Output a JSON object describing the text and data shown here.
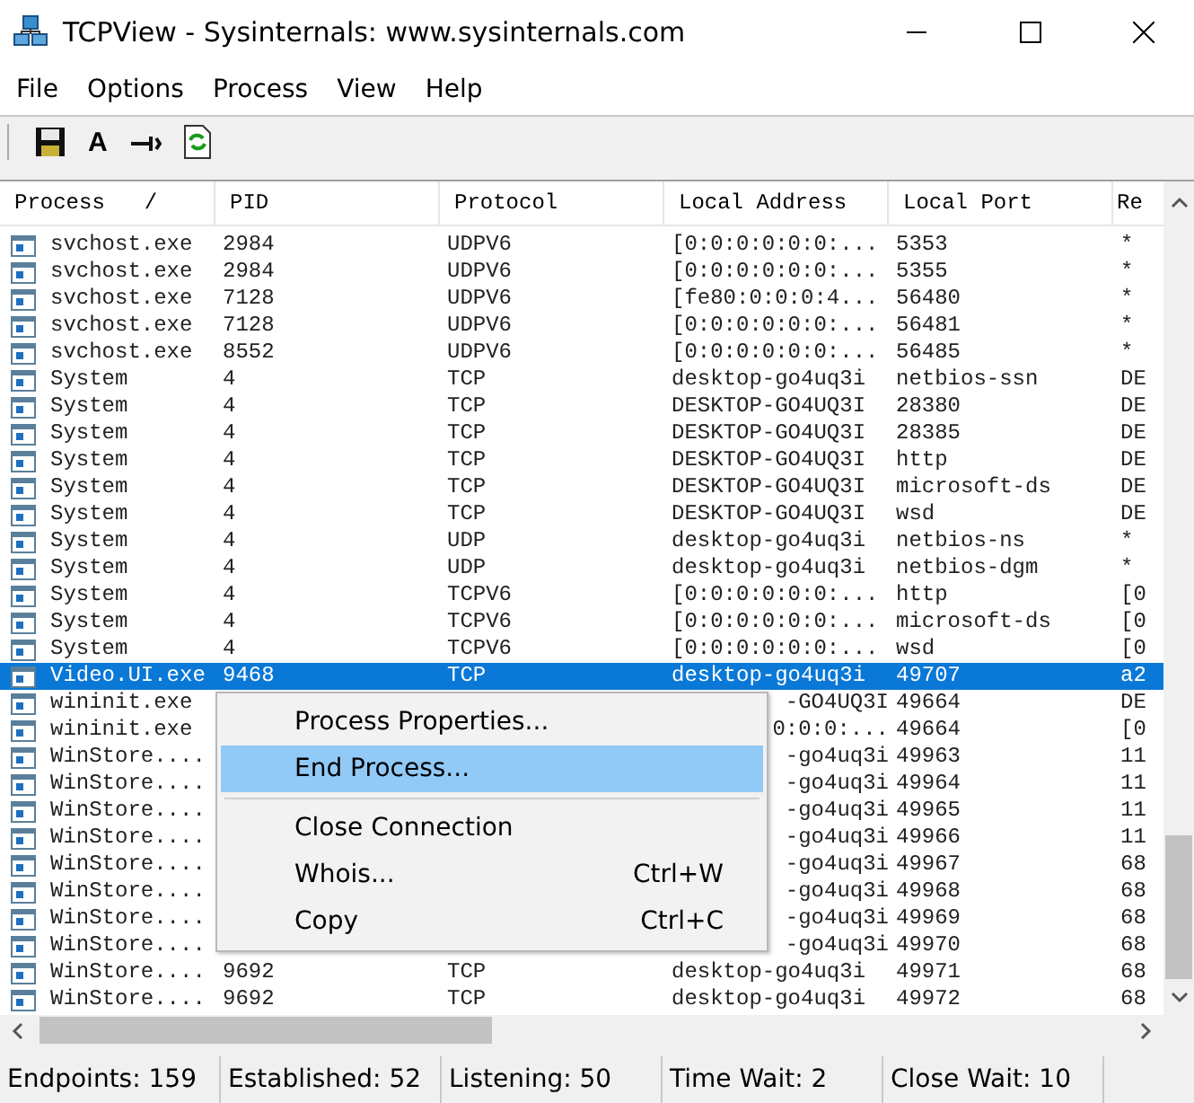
{
  "window": {
    "title": "TCPView - Sysinternals: www.sysinternals.com"
  },
  "menu_bar": [
    "File",
    "Options",
    "Process",
    "View",
    "Help"
  ],
  "toolbar": [
    {
      "kind": "save"
    },
    {
      "kind": "glyph",
      "label": "A"
    },
    {
      "kind": "connector"
    },
    {
      "kind": "refresh"
    }
  ],
  "table": {
    "columns": [
      {
        "label": "Process",
        "sort_indicator": "/"
      },
      {
        "label": "PID"
      },
      {
        "label": "Protocol"
      },
      {
        "label": "Local Address"
      },
      {
        "label": "Local Port"
      },
      {
        "label": "Re"
      }
    ],
    "rows": [
      {
        "cells": [
          "svchost.exe",
          "2984",
          "UDPV6",
          "[0:0:0:0:0:0:...",
          "5353",
          "*"
        ],
        "selected": false
      },
      {
        "cells": [
          "svchost.exe",
          "2984",
          "UDPV6",
          "[0:0:0:0:0:0:...",
          "5355",
          "*"
        ],
        "selected": false
      },
      {
        "cells": [
          "svchost.exe",
          "7128",
          "UDPV6",
          "[fe80:0:0:0:4...",
          "56480",
          "*"
        ],
        "selected": false
      },
      {
        "cells": [
          "svchost.exe",
          "7128",
          "UDPV6",
          "[0:0:0:0:0:0:...",
          "56481",
          "*"
        ],
        "selected": false
      },
      {
        "cells": [
          "svchost.exe",
          "8552",
          "UDPV6",
          "[0:0:0:0:0:0:...",
          "56485",
          "*"
        ],
        "selected": false
      },
      {
        "cells": [
          "System",
          "4",
          "TCP",
          "desktop-go4uq3i",
          "netbios-ssn",
          "DE"
        ],
        "selected": false
      },
      {
        "cells": [
          "System",
          "4",
          "TCP",
          "DESKTOP-GO4UQ3I",
          "28380",
          "DE"
        ],
        "selected": false
      },
      {
        "cells": [
          "System",
          "4",
          "TCP",
          "DESKTOP-GO4UQ3I",
          "28385",
          "DE"
        ],
        "selected": false
      },
      {
        "cells": [
          "System",
          "4",
          "TCP",
          "DESKTOP-GO4UQ3I",
          "http",
          "DE"
        ],
        "selected": false
      },
      {
        "cells": [
          "System",
          "4",
          "TCP",
          "DESKTOP-GO4UQ3I",
          "microsoft-ds",
          "DE"
        ],
        "selected": false
      },
      {
        "cells": [
          "System",
          "4",
          "TCP",
          "DESKTOP-GO4UQ3I",
          "wsd",
          "DE"
        ],
        "selected": false
      },
      {
        "cells": [
          "System",
          "4",
          "UDP",
          "desktop-go4uq3i",
          "netbios-ns",
          "*"
        ],
        "selected": false
      },
      {
        "cells": [
          "System",
          "4",
          "UDP",
          "desktop-go4uq3i",
          "netbios-dgm",
          "*"
        ],
        "selected": false
      },
      {
        "cells": [
          "System",
          "4",
          "TCPV6",
          "[0:0:0:0:0:0:...",
          "http",
          "[0"
        ],
        "selected": false
      },
      {
        "cells": [
          "System",
          "4",
          "TCPV6",
          "[0:0:0:0:0:0:...",
          "microsoft-ds",
          "[0"
        ],
        "selected": false
      },
      {
        "cells": [
          "System",
          "4",
          "TCPV6",
          "[0:0:0:0:0:0:...",
          "wsd",
          "[0"
        ],
        "selected": false
      },
      {
        "cells": [
          "Video.UI.exe",
          "9468",
          "TCP",
          "desktop-go4uq3i",
          "49707",
          "a2"
        ],
        "selected": true
      },
      {
        "cells": [
          "wininit.exe",
          null,
          null,
          "-GO4UQ3I",
          "49664",
          "DE"
        ],
        "selected": false
      },
      {
        "cells": [
          "wininit.exe",
          null,
          null,
          "0:0:0:...",
          "49664",
          "[0"
        ],
        "selected": false
      },
      {
        "cells": [
          "WinStore....",
          null,
          null,
          "-go4uq3i",
          "49963",
          "11"
        ],
        "selected": false
      },
      {
        "cells": [
          "WinStore....",
          null,
          null,
          "-go4uq3i",
          "49964",
          "11"
        ],
        "selected": false
      },
      {
        "cells": [
          "WinStore....",
          null,
          null,
          "-go4uq3i",
          "49965",
          "11"
        ],
        "selected": false
      },
      {
        "cells": [
          "WinStore....",
          null,
          null,
          "-go4uq3i",
          "49966",
          "11"
        ],
        "selected": false
      },
      {
        "cells": [
          "WinStore....",
          null,
          null,
          "-go4uq3i",
          "49967",
          "68"
        ],
        "selected": false
      },
      {
        "cells": [
          "WinStore....",
          null,
          null,
          "-go4uq3i",
          "49968",
          "68"
        ],
        "selected": false
      },
      {
        "cells": [
          "WinStore....",
          null,
          null,
          "-go4uq3i",
          "49969",
          "68"
        ],
        "selected": false
      },
      {
        "cells": [
          "WinStore....",
          null,
          null,
          "-go4uq3i",
          "49970",
          "68"
        ],
        "selected": false
      },
      {
        "cells": [
          "WinStore....",
          "9692",
          "TCP",
          "desktop-go4uq3i",
          "49971",
          "68"
        ],
        "selected": false
      },
      {
        "cells": [
          "WinStore....",
          "9692",
          "TCP",
          "desktop-go4uq3i",
          "49972",
          "68"
        ],
        "selected": false
      }
    ]
  },
  "context_menu": [
    {
      "kind": "item",
      "label": "Process Properties...",
      "selected": false
    },
    {
      "kind": "item",
      "label": "End Process...",
      "selected": true
    },
    {
      "kind": "separator"
    },
    {
      "kind": "item",
      "label": "Close Connection",
      "selected": false
    },
    {
      "kind": "item",
      "label": "Whois...",
      "shortcut": "Ctrl+W",
      "selected": false
    },
    {
      "kind": "item",
      "label": "Copy",
      "shortcut": "Ctrl+C",
      "selected": false
    }
  ],
  "status_bar": [
    "Endpoints: 159",
    "Established: 52",
    "Listening: 50",
    "Time Wait: 2",
    "Close Wait: 10"
  ]
}
